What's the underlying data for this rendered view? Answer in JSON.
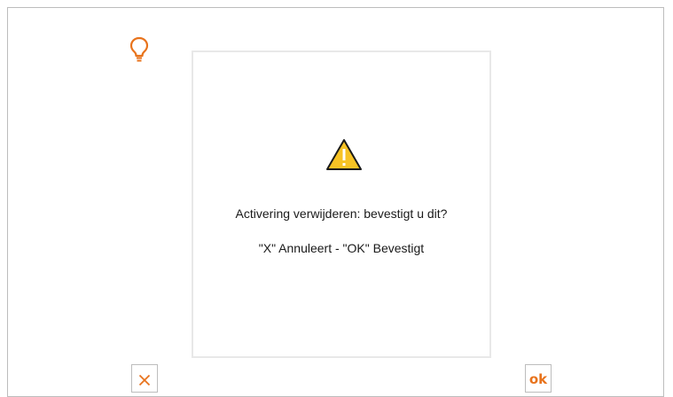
{
  "colors": {
    "accent": "#e8731c",
    "warning": "#f7c325",
    "border": "#bdbdbd"
  },
  "header": {
    "icon": "lightbulb-icon"
  },
  "dialog": {
    "icon": "warning-triangle-icon",
    "message": "Activering verwijderen: bevestigt u dit?",
    "instructions": "\"X\" Annuleert - \"OK\" Bevestigt"
  },
  "buttons": {
    "cancel": {
      "icon": "close-icon"
    },
    "confirm": {
      "label": "ok"
    }
  }
}
